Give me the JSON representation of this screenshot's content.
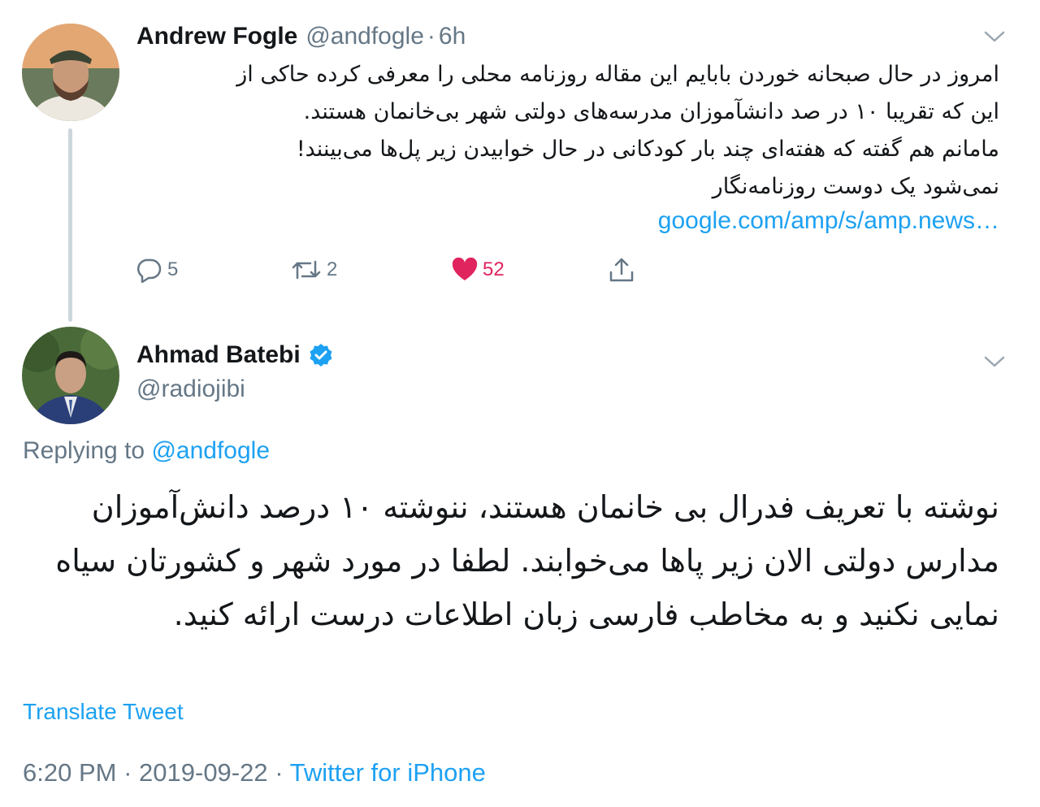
{
  "parent_tweet": {
    "display_name": "Andrew Fogle",
    "handle": "@andfogle",
    "separator": "·",
    "time": "6h",
    "text_lines": [
      "امروز در حال صبحانه خوردن بابایم این مقاله روزنامه محلی را معرفی کرده حاکی از",
      "این که تقریبا ۱۰ در صد دانشآموزان مدرسه‌های دولتی شهر بی‌خانمان هستند.",
      "مامانم هم گفته که هفته‌ای چند بار کودکانی در حال خوابیدن زیر پل‌ها می‌بینند!",
      "نمی‌شود یک دوست روزنامه‌نگار"
    ],
    "link": "google.com/amp/s/amp.news…",
    "actions": {
      "replies": "5",
      "retweets": "2",
      "likes": "52"
    }
  },
  "reply_tweet": {
    "display_name": "Ahmad Batebi",
    "handle": "@radiojibi",
    "replying_prefix": "Replying to",
    "replying_to": "@andfogle",
    "text_lines": [
      "نوشته با تعریف فدرال بی خانمان هستند، ننوشته ۱۰ درصد دانش‌آموزان",
      "مدارس دولتی الان زیر پاها می‌خوابند. لطفا در مورد شهر و کشورتان سیاه",
      "نمایی نکنید و به مخاطب فارسی زبان اطلاعات درست ارائه کنید."
    ],
    "translate_label": "Translate Tweet",
    "time": "6:20 PM",
    "date": "2019-09-22",
    "separator": "·",
    "source": "Twitter for iPhone"
  },
  "colors": {
    "accent": "#1da1f2",
    "muted": "#657786",
    "like": "#e0245e",
    "text": "#14171a"
  },
  "icons": [
    "reply-icon",
    "retweet-icon",
    "like-heart-icon",
    "share-icon",
    "chevron-down-icon",
    "verified-badge-icon"
  ]
}
